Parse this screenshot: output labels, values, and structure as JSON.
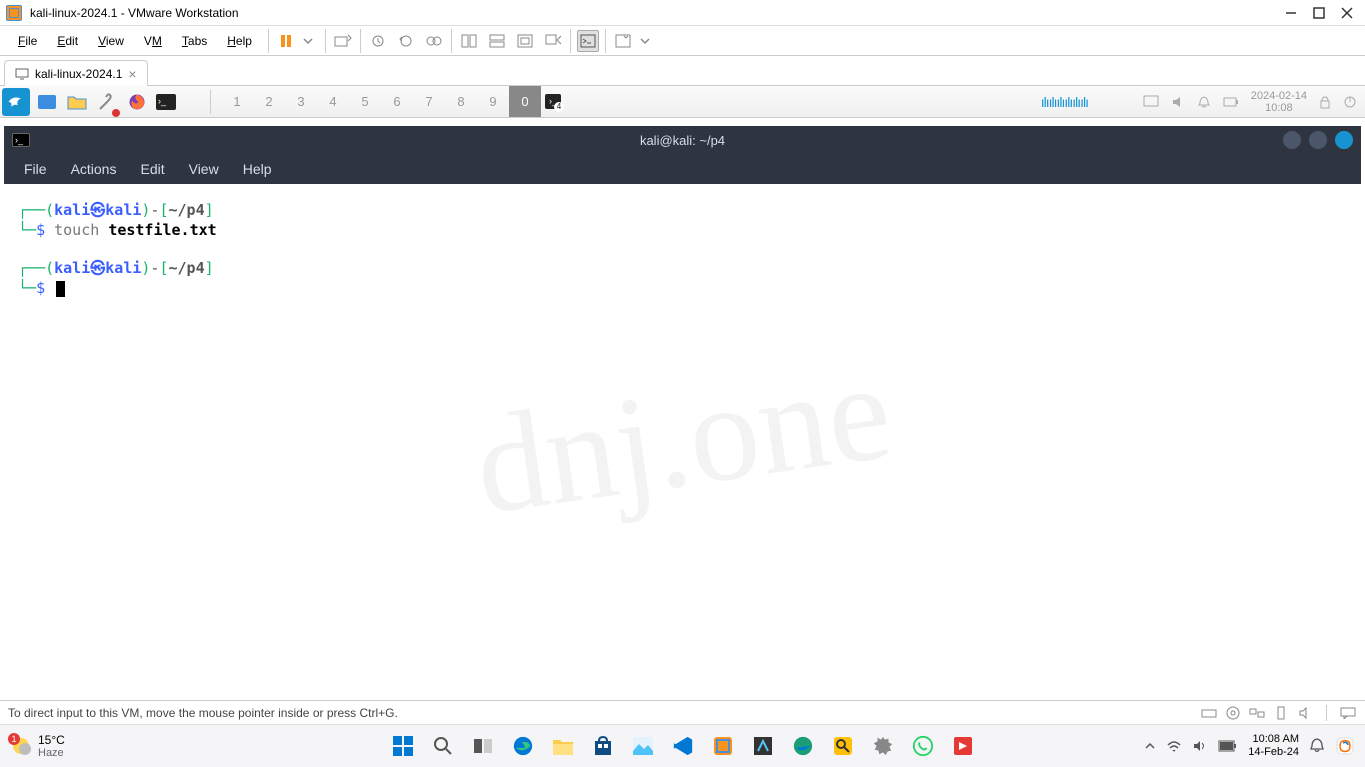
{
  "vmware": {
    "title": "kali-linux-2024.1 - VMware Workstation",
    "menus": [
      "File",
      "Edit",
      "View",
      "VM",
      "Tabs",
      "Help"
    ],
    "tab": {
      "label": "kali-linux-2024.1"
    },
    "status": "To direct input to this VM, move the mouse pointer inside or press Ctrl+G."
  },
  "kali_panel": {
    "workspaces": [
      "1",
      "2",
      "3",
      "4",
      "5",
      "6",
      "7",
      "8",
      "9",
      "0"
    ],
    "active_workspace": "0",
    "term_badge": "4",
    "date": "2024-02-14",
    "time": "10:08"
  },
  "terminal": {
    "title": "kali@kali: ~/p4",
    "menus": [
      "File",
      "Actions",
      "Edit",
      "View",
      "Help"
    ],
    "user": "kali",
    "host": "kali",
    "path": "~/p4",
    "command": "touch",
    "argument": "testfile.txt",
    "symbol_at": "㉿",
    "dollar": "$"
  },
  "windows": {
    "weather_temp": "15°C",
    "weather_desc": "Haze",
    "weather_badge": "1",
    "clock_time": "10:08 AM",
    "clock_date": "14-Feb-24"
  },
  "watermark": "dnj.one"
}
